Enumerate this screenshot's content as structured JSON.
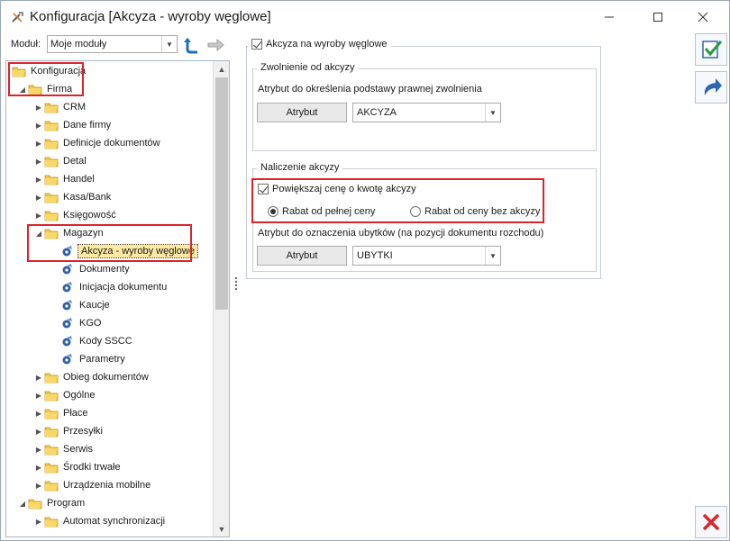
{
  "window": {
    "title": "Konfiguracja [Akcyza - wyroby węglowe]",
    "accent": "#d9252b"
  },
  "module": {
    "label": "Moduł:",
    "selected": "Moje moduły"
  },
  "tree": [
    {
      "label": "Konfiguracja",
      "level": 0,
      "expander": "none",
      "icon": "folder-icon"
    },
    {
      "label": "Firma",
      "level": 1,
      "expander": "expanded",
      "icon": "folder-icon"
    },
    {
      "label": "CRM",
      "level": 2,
      "expander": "collapsed",
      "icon": "folder-icon"
    },
    {
      "label": "Dane firmy",
      "level": 2,
      "expander": "collapsed",
      "icon": "folder-icon"
    },
    {
      "label": "Definicje dokumentów",
      "level": 2,
      "expander": "collapsed",
      "icon": "folder-icon"
    },
    {
      "label": "Detal",
      "level": 2,
      "expander": "collapsed",
      "icon": "folder-icon"
    },
    {
      "label": "Handel",
      "level": 2,
      "expander": "collapsed",
      "icon": "folder-icon"
    },
    {
      "label": "Kasa/Bank",
      "level": 2,
      "expander": "collapsed",
      "icon": "folder-icon"
    },
    {
      "label": "Księgowość",
      "level": 2,
      "expander": "collapsed",
      "icon": "folder-icon"
    },
    {
      "label": "Magazyn",
      "level": 2,
      "expander": "expanded",
      "icon": "folder-icon"
    },
    {
      "label": "Akcyza - wyroby węglowe",
      "level": 3,
      "expander": "none",
      "icon": "settings-leaf-icon",
      "selected": true
    },
    {
      "label": "Dokumenty",
      "level": 3,
      "expander": "none",
      "icon": "settings-leaf-icon"
    },
    {
      "label": "Inicjacja dokumentu",
      "level": 3,
      "expander": "none",
      "icon": "settings-leaf-icon"
    },
    {
      "label": "Kaucje",
      "level": 3,
      "expander": "none",
      "icon": "settings-leaf-icon"
    },
    {
      "label": "KGO",
      "level": 3,
      "expander": "none",
      "icon": "settings-leaf-icon"
    },
    {
      "label": "Kody SSCC",
      "level": 3,
      "expander": "none",
      "icon": "settings-leaf-icon"
    },
    {
      "label": "Parametry",
      "level": 3,
      "expander": "none",
      "icon": "settings-leaf-icon"
    },
    {
      "label": "Obieg dokumentów",
      "level": 2,
      "expander": "collapsed",
      "icon": "folder-icon"
    },
    {
      "label": "Ogólne",
      "level": 2,
      "expander": "collapsed",
      "icon": "folder-icon"
    },
    {
      "label": "Płace",
      "level": 2,
      "expander": "collapsed",
      "icon": "folder-icon"
    },
    {
      "label": "Przesyłki",
      "level": 2,
      "expander": "collapsed",
      "icon": "folder-icon"
    },
    {
      "label": "Serwis",
      "level": 2,
      "expander": "collapsed",
      "icon": "folder-icon"
    },
    {
      "label": "Środki trwałe",
      "level": 2,
      "expander": "collapsed",
      "icon": "folder-icon"
    },
    {
      "label": "Urządzenia mobilne",
      "level": 2,
      "expander": "collapsed",
      "icon": "folder-icon"
    },
    {
      "label": "Program",
      "level": 1,
      "expander": "expanded",
      "icon": "folder-icon"
    },
    {
      "label": "Automat synchronizacji",
      "level": 2,
      "expander": "collapsed",
      "icon": "folder-icon"
    }
  ],
  "form": {
    "main_checkbox": {
      "label": "Akcyza na wyroby węglowe",
      "checked": true
    },
    "exemption_group": {
      "legend": "Zwolnienie od akcyzy",
      "description": "Atrybut do określenia podstawy prawnej zwolnienia",
      "attr_button": "Atrybut",
      "attr_value": "AKCYZA"
    },
    "charge_group": {
      "legend": "Naliczenie akcyzy",
      "increase_checkbox": {
        "label": "Powiększaj cenę o kwotę akcyzy",
        "checked": true
      },
      "radio_full": {
        "label": "Rabat od pełnej ceny",
        "checked": true
      },
      "radio_net": {
        "label": "Rabat od ceny bez akcyzy",
        "checked": false
      },
      "description": "Atrybut do oznaczenia ubytków (na pozycji dokumentu rozchodu)",
      "attr_button": "Atrybut",
      "attr_value": "UBYTKI"
    }
  }
}
